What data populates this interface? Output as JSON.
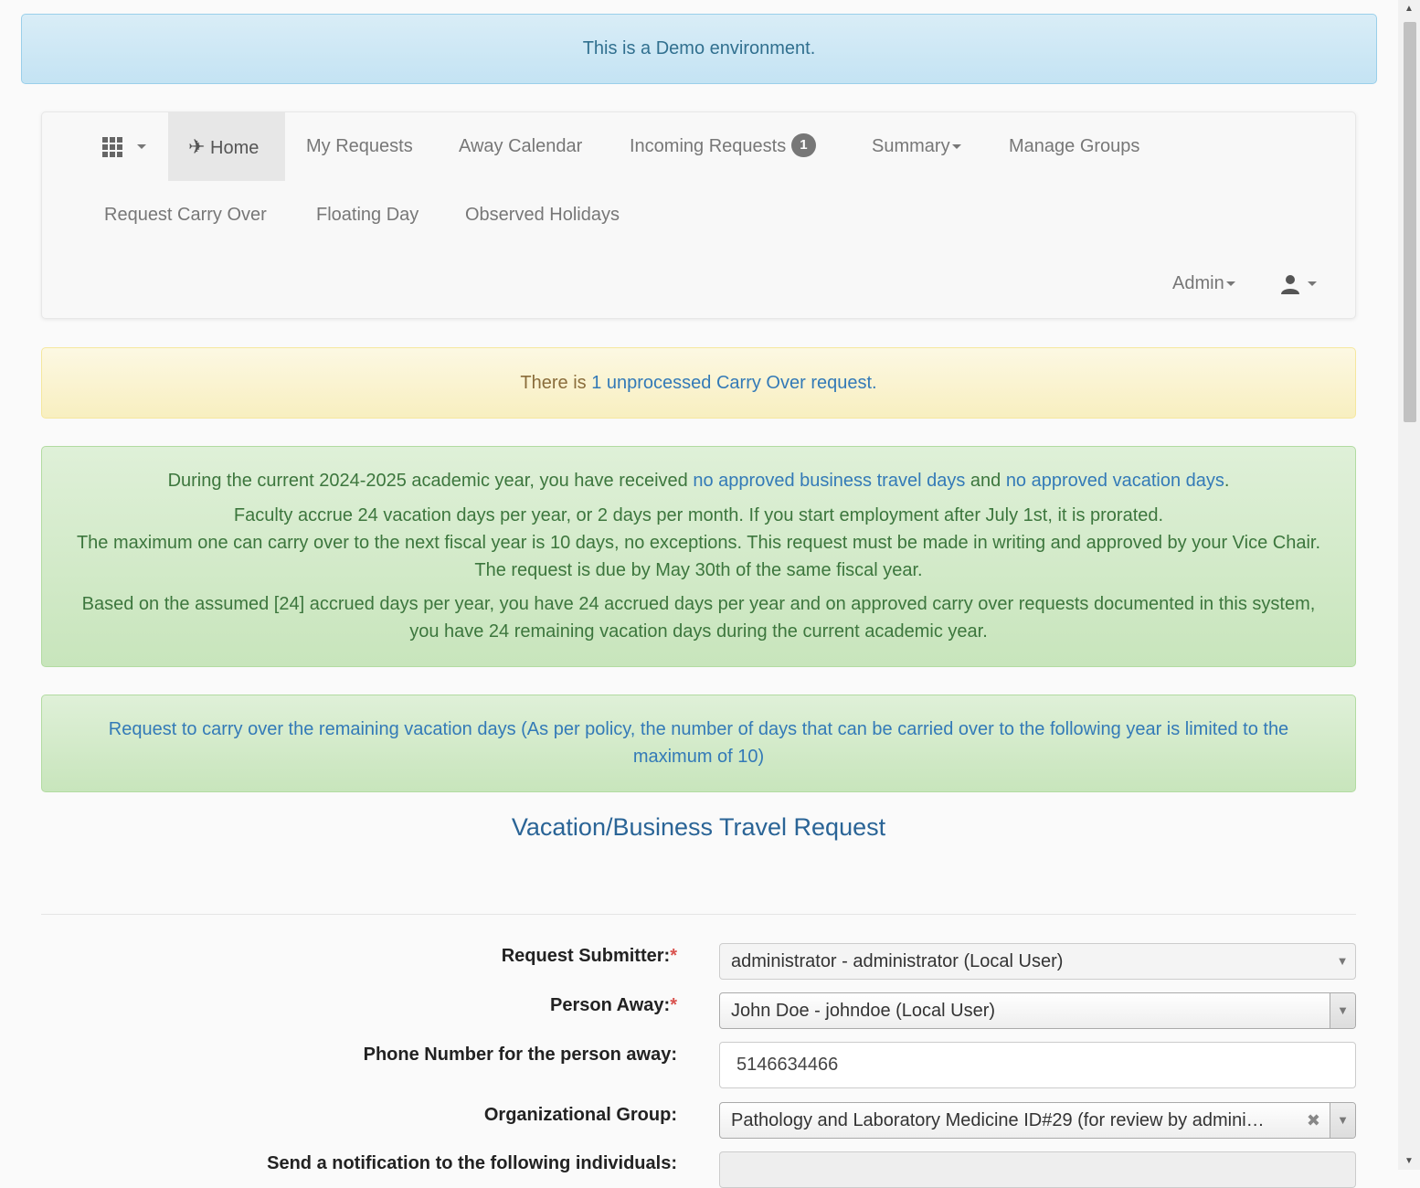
{
  "demo_banner": "This is a Demo environment.",
  "nav": {
    "home": "Home",
    "my_requests": "My Requests",
    "away_calendar": "Away Calendar",
    "incoming_requests": "Incoming Requests",
    "incoming_count": "1",
    "summary": "Summary",
    "manage_groups": "Manage Groups",
    "request_carry_over": "Request Carry Over",
    "floating_day": "Floating Day",
    "observed_holidays": "Observed Holidays",
    "admin": "Admin"
  },
  "warning": {
    "prefix": "There is ",
    "link": "1 unprocessed Carry Over request."
  },
  "info": {
    "line1_prefix": "During the current 2024-2025 academic year, you have received ",
    "line1_link1": "no approved business travel days",
    "line1_mid": " and ",
    "line1_link2": "no approved vacation days",
    "line1_suffix": ".",
    "line2": "Faculty accrue 24 vacation days per year, or 2 days per month. If you start employment after July 1st, it is prorated.",
    "line3": "The maximum one can carry over to the next fiscal year is 10 days, no exceptions. This request must be made in writing and approved by your Vice Chair. The request is due by May 30th of the same fiscal year.",
    "line4": "Based on the assumed [24] accrued days per year, you have 24 accrued days per year and on approved carry over requests documented in this system, you have 24 remaining vacation days during the current academic year."
  },
  "carry_over_link": "Request to carry over the remaining vacation days (As per policy, the number of days that can be carried over to the following year is limited to the maximum of 10)",
  "form": {
    "title": "Vacation/Business Travel Request",
    "submitter_label": "Request Submitter:",
    "submitter_value": "administrator - administrator (Local User)",
    "person_away_label": "Person Away:",
    "person_away_value": "John Doe - johndoe (Local User)",
    "phone_label": "Phone Number for the person away:",
    "phone_value": "5146634466",
    "org_group_label": "Organizational Group:",
    "org_group_value": "Pathology and Laboratory Medicine ID#29 (for review by admini…",
    "notify_label": "Send a notification to the following individuals:",
    "required_mark": "*"
  }
}
